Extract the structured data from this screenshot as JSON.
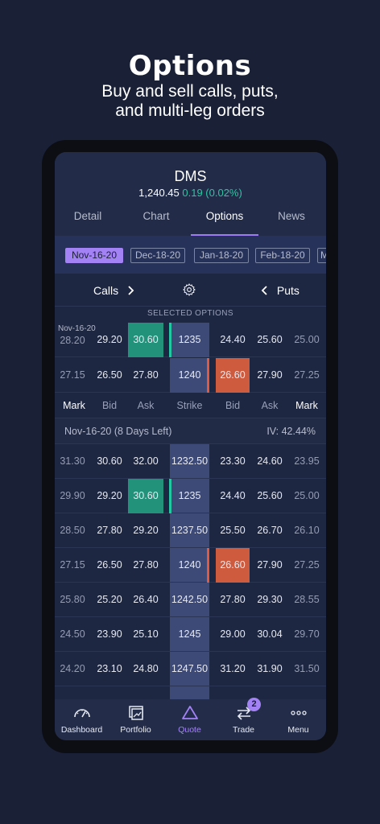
{
  "promo": {
    "title": "Options",
    "subtitle_line1": "Buy and sell calls, puts,",
    "subtitle_line2": "and multi-leg orders"
  },
  "header": {
    "symbol": "DMS",
    "price": "1,240.45",
    "change": "0.19 (0.02%)"
  },
  "tabs": [
    "Detail",
    "Chart",
    "Options",
    "News"
  ],
  "active_tab": "Options",
  "expiry_dates": [
    "Nov-16-20",
    "Dec-18-20",
    "Jan-18-20",
    "Feb-18-20",
    "M"
  ],
  "selected_expiry": "Nov-16-20",
  "calls_puts": {
    "calls": "Calls",
    "puts": "Puts"
  },
  "selected_options": {
    "header": "SELECTED OPTIONS",
    "date_label": "Nov-16-20",
    "rows": [
      [
        "28.20",
        "29.20",
        "30.60",
        "1235",
        "24.40",
        "25.60",
        "25.00"
      ],
      [
        "27.15",
        "26.50",
        "27.80",
        "1240",
        "26.60",
        "27.90",
        "27.25"
      ]
    ]
  },
  "columns": [
    "Mark",
    "Bid",
    "Ask",
    "Strike",
    "Bid",
    "Ask",
    "Mark"
  ],
  "expiry_info": {
    "label": "Nov-16-20  (8 Days Left)",
    "iv": "IV: 42.44%"
  },
  "chain_rows": [
    [
      "31.30",
      "30.60",
      "32.00",
      "1232.50",
      "23.30",
      "24.60",
      "23.95"
    ],
    [
      "29.90",
      "29.20",
      "30.60",
      "1235",
      "24.40",
      "25.60",
      "25.00"
    ],
    [
      "28.50",
      "27.80",
      "29.20",
      "1237.50",
      "25.50",
      "26.70",
      "26.10"
    ],
    [
      "27.15",
      "26.50",
      "27.80",
      "1240",
      "26.60",
      "27.90",
      "27.25"
    ],
    [
      "25.80",
      "25.20",
      "26.40",
      "1242.50",
      "27.80",
      "29.30",
      "28.55"
    ],
    [
      "24.50",
      "23.90",
      "25.10",
      "1245",
      "29.00",
      "30.04",
      "29.70"
    ],
    [
      "24.20",
      "23.10",
      "24.80",
      "1247.50",
      "31.20",
      "31.90",
      "31.50"
    ]
  ],
  "nav": [
    {
      "label": "Dashboard",
      "icon": "gauge-icon"
    },
    {
      "label": "Portfolio",
      "icon": "portfolio-icon"
    },
    {
      "label": "Quote",
      "icon": "triangle-icon"
    },
    {
      "label": "Trade",
      "icon": "swap-arrows-icon",
      "badge": "2"
    },
    {
      "label": "Menu",
      "icon": "more-dots-icon"
    }
  ],
  "colors": {
    "background": "#1a2036",
    "accent": "#a382f6",
    "positive": "#2ec4a2",
    "call_highlight": "#23927a",
    "put_highlight": "#cf5b3f"
  }
}
